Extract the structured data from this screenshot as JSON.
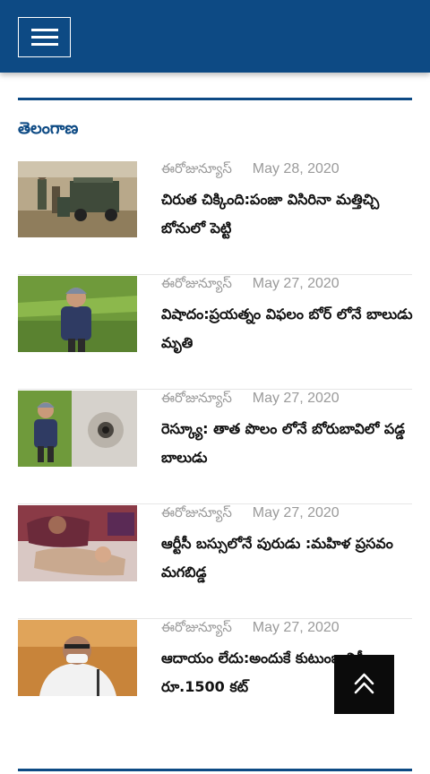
{
  "header": {
    "menu_icon": "hamburger-menu-icon",
    "brand_color": "#0d4a84"
  },
  "section": {
    "title": "తెలంగాణ"
  },
  "news": [
    {
      "source": "ఈరోజున్యూస్",
      "date": "May 28, 2020",
      "headline": "చిరుత చిక్కింది:పంజా విసిరినా మత్తిచ్చి బోనులో పెట్టి"
    },
    {
      "source": "ఈరోజున్యూస్",
      "date": "May 27, 2020",
      "headline": "విషాదం:ప్రయత్నం విఫలం బోర్ లోనే బాలుడు మృతి"
    },
    {
      "source": "ఈరోజున్యూస్",
      "date": "May 27, 2020",
      "headline": "రెస్క్యూ: తాత పొలం లోనే బోరుబావిలో పడ్డ బాలుడు"
    },
    {
      "source": "ఈరోజున్యూస్",
      "date": "May 27, 2020",
      "headline": "ఆర్టీసీ బస్సులోనే పురుడు :మహిళ ప్రసవం మగబిడ్డ"
    },
    {
      "source": "ఈరోజున్యూస్",
      "date": "May 27, 2020",
      "headline": "ఆదాయం లేదు:అందుకే కుటుంబానికీ రూ.1500 కట్"
    }
  ],
  "scroll_top": {
    "icon": "double-chevron-up-icon"
  }
}
